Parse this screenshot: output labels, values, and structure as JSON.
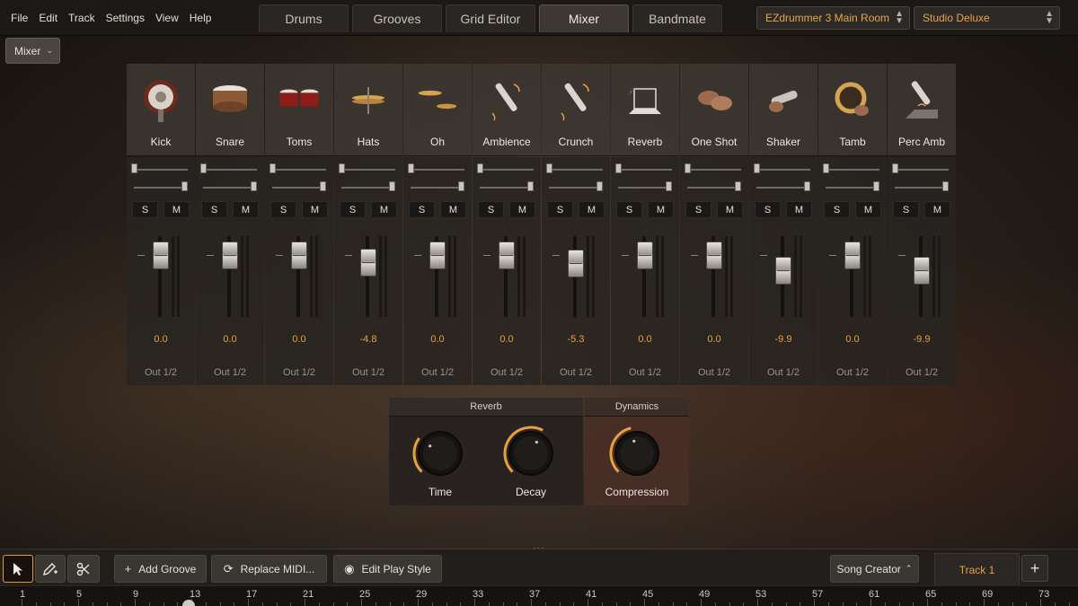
{
  "menu": [
    "File",
    "Edit",
    "Track",
    "Settings",
    "View",
    "Help"
  ],
  "tabs": [
    {
      "label": "Drums",
      "active": false
    },
    {
      "label": "Grooves",
      "active": false
    },
    {
      "label": "Grid Editor",
      "active": false
    },
    {
      "label": "Mixer",
      "active": true
    },
    {
      "label": "Bandmate",
      "active": false
    }
  ],
  "room_select": "EZdrummer 3 Main Room",
  "preset_select": "Studio Deluxe",
  "mixer_dropdown": "Mixer",
  "channels": [
    {
      "name": "Kick",
      "db": "0.0",
      "out": "Out 1/2",
      "fader": 0.0,
      "icon": "kick-drum-icon",
      "solo": "S",
      "mute": "M"
    },
    {
      "name": "Snare",
      "db": "0.0",
      "out": "Out 1/2",
      "fader": 0.0,
      "icon": "snare-drum-icon",
      "solo": "S",
      "mute": "M"
    },
    {
      "name": "Toms",
      "db": "0.0",
      "out": "Out 1/2",
      "fader": 0.0,
      "icon": "toms-icon",
      "solo": "S",
      "mute": "M"
    },
    {
      "name": "Hats",
      "db": "-4.8",
      "out": "Out 1/2",
      "fader": -4.8,
      "icon": "hihat-icon",
      "solo": "S",
      "mute": "M"
    },
    {
      "name": "Oh",
      "db": "0.0",
      "out": "Out 1/2",
      "fader": 0.0,
      "icon": "overhead-cymbals-icon",
      "solo": "S",
      "mute": "M"
    },
    {
      "name": "Ambience",
      "db": "0.0",
      "out": "Out 1/2",
      "fader": 0.0,
      "icon": "ambience-mic-icon",
      "solo": "S",
      "mute": "M"
    },
    {
      "name": "Crunch",
      "db": "-5.3",
      "out": "Out 1/2",
      "fader": -5.3,
      "icon": "crunch-mic-icon",
      "solo": "S",
      "mute": "M"
    },
    {
      "name": "Reverb",
      "db": "0.0",
      "out": "Out 1/2",
      "fader": 0.0,
      "icon": "reverb-room-icon",
      "solo": "S",
      "mute": "M"
    },
    {
      "name": "One Shot",
      "db": "0.0",
      "out": "Out 1/2",
      "fader": 0.0,
      "icon": "one-shot-hands-icon",
      "solo": "S",
      "mute": "M"
    },
    {
      "name": "Shaker",
      "db": "-9.9",
      "out": "Out 1/2",
      "fader": -9.9,
      "icon": "shaker-icon",
      "solo": "S",
      "mute": "M"
    },
    {
      "name": "Tamb",
      "db": "0.0",
      "out": "Out 1/2",
      "fader": 0.0,
      "icon": "tambourine-icon",
      "solo": "S",
      "mute": "M"
    },
    {
      "name": "Perc Amb",
      "db": "-9.9",
      "out": "Out 1/2",
      "fader": -9.9,
      "icon": "perc-ambience-mic-icon",
      "solo": "S",
      "mute": "M"
    }
  ],
  "fx": {
    "reverb_title": "Reverb",
    "dynamics_title": "Dynamics",
    "knobs": [
      {
        "label": "Time",
        "value": 0.3
      },
      {
        "label": "Decay",
        "value": 0.6
      },
      {
        "label": "Compression",
        "value": 0.45
      }
    ]
  },
  "toolbar": {
    "select_tool_icon": "pointer-icon",
    "draw_tool_icon": "pencil-icon",
    "cut_tool_icon": "scissors-icon",
    "add_groove": "Add Groove",
    "replace_midi": "Replace MIDI...",
    "edit_play_style": "Edit Play Style",
    "song_creator": "Song Creator",
    "track": "Track 1",
    "add_track": "+"
  },
  "ruler": [
    "1",
    "5",
    "9",
    "13",
    "17",
    "21",
    "25",
    "29",
    "33",
    "37",
    "41",
    "45",
    "49",
    "53",
    "57",
    "61",
    "65",
    "69",
    "73"
  ],
  "colors": {
    "accent": "#e8a03f",
    "panel": "#3e3833"
  }
}
